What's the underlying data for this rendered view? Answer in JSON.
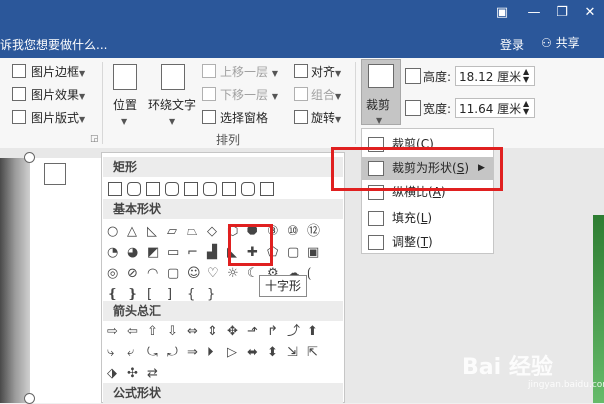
{
  "titlebar": {
    "tell_me": "诉我您想要做什么...",
    "login": "登录",
    "share": "共享"
  },
  "ribbon": {
    "picture_border": "图片边框",
    "picture_effects": "图片效果",
    "picture_layout": "图片版式",
    "position": "位置",
    "wrap_text": "环绕文字",
    "bring_forward": "上移一层",
    "send_backward": "下移一层",
    "selection_pane": "选择窗格",
    "align": "对齐",
    "group": "组合",
    "rotate": "旋转",
    "arrange_group": "排列",
    "crop": "裁剪",
    "height_label": "高度:",
    "height_value": "18.12 厘米",
    "width_label": "宽度:",
    "width_value": "11.64 厘米"
  },
  "crop_menu": {
    "items": [
      {
        "label": "裁剪(",
        "key": "C",
        "close": ")",
        "icon": "crop-icon"
      },
      {
        "label": "裁剪为形状(",
        "key": "S",
        "close": ")",
        "icon": "crop-to-shape-icon",
        "highlighted": true
      },
      {
        "label": "纵横比(",
        "key": "A",
        "close": ")",
        "icon": "aspect-ratio-icon"
      },
      {
        "label": "填充(",
        "key": "L",
        "close": ")",
        "icon": "fill-icon"
      },
      {
        "label": "调整(",
        "key": "T",
        "close": ")",
        "icon": "fit-icon"
      }
    ]
  },
  "gallery": {
    "categories": [
      "矩形",
      "基本形状",
      "箭头总汇",
      "公式形状"
    ],
    "tooltip": "十字形"
  },
  "watermark": {
    "text": "Bai 经验",
    "sub": "jingyan.baidu.com"
  },
  "colors": {
    "titlebar": "#2b579a",
    "highlight": "#e02020",
    "menu_hover": "#c5c5c5"
  }
}
